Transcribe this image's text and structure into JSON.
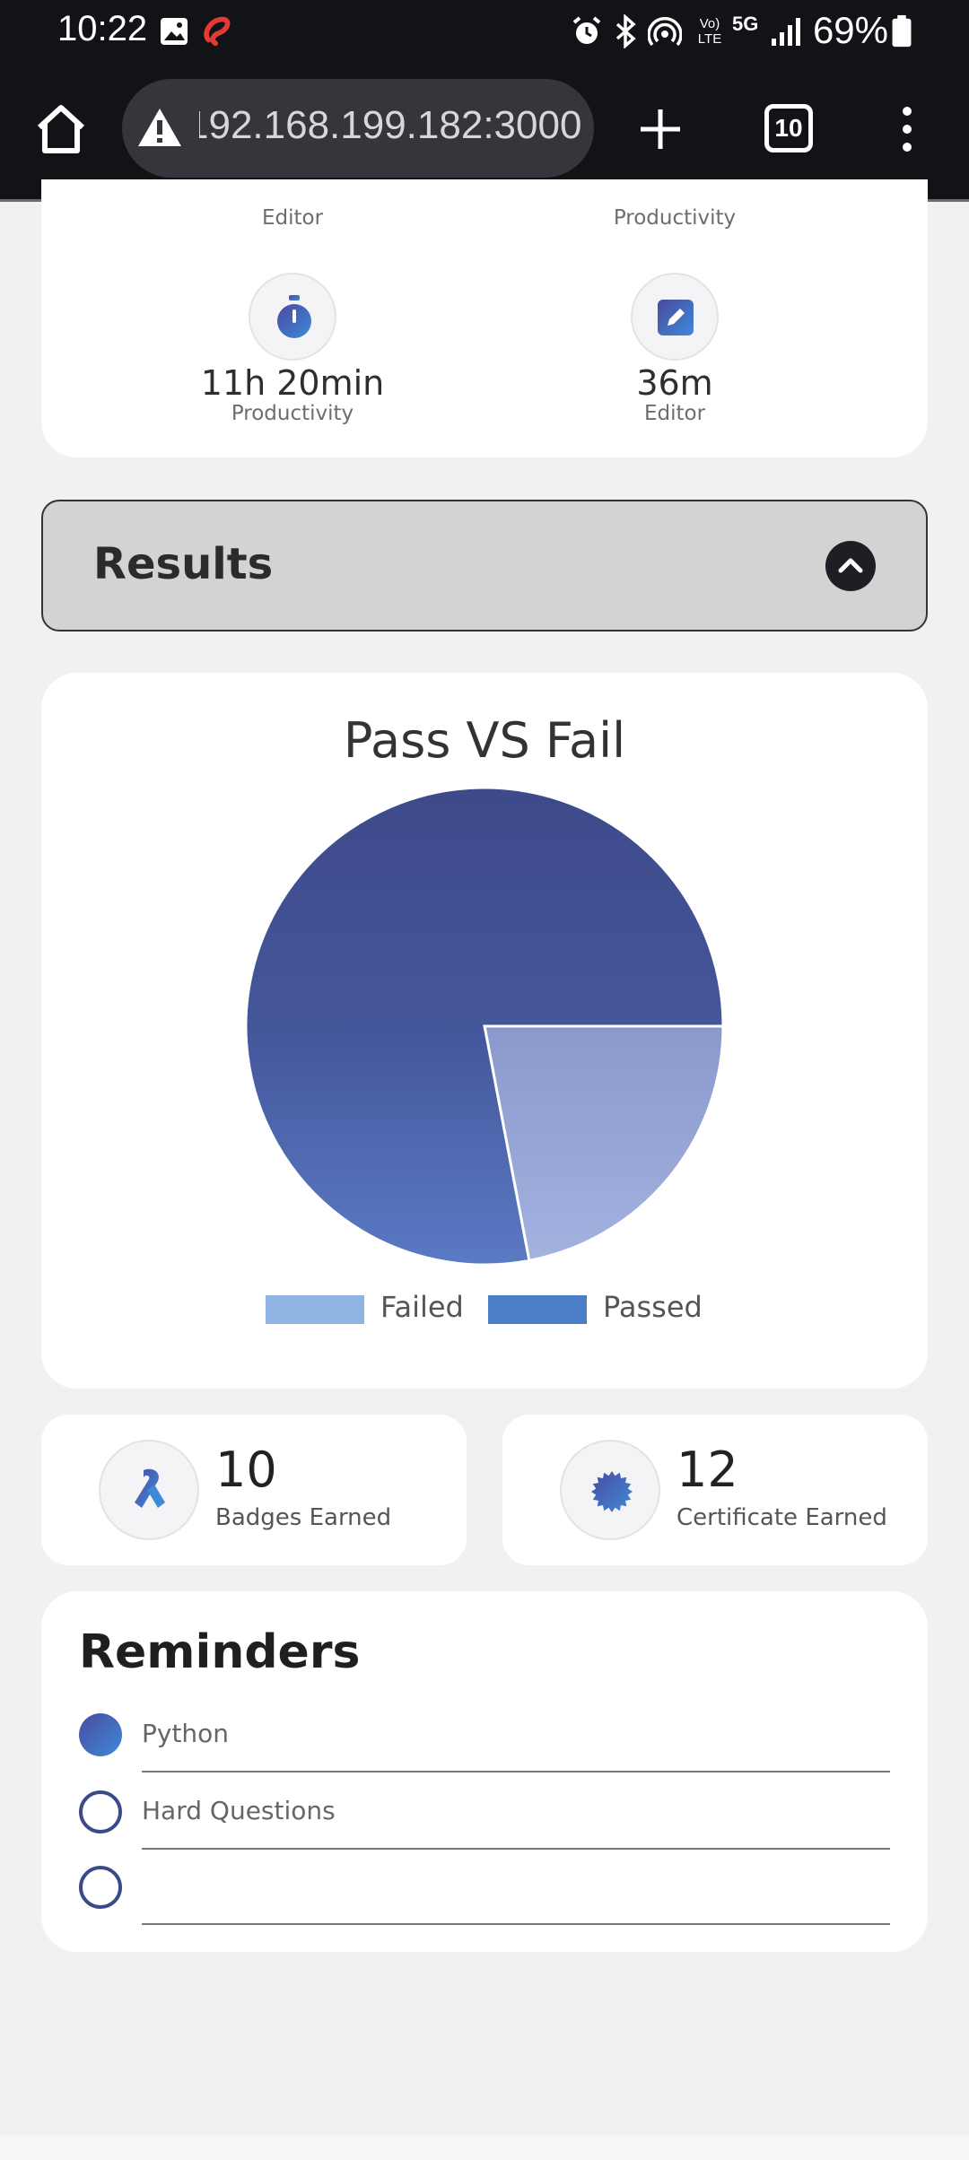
{
  "status_bar": {
    "time": "10:22",
    "battery": "69%",
    "network": "5G",
    "volte": "Vo) LTE"
  },
  "browser": {
    "url": "192.168.199.182:3000",
    "tab_count": "10"
  },
  "stats": {
    "top_labels": [
      "Editor",
      "Productivity"
    ],
    "items": [
      {
        "value": "11h 20min",
        "label": "Productivity",
        "icon": "stopwatch-icon"
      },
      {
        "value": "36m",
        "label": "Editor",
        "icon": "pencil-icon"
      }
    ]
  },
  "results": {
    "title": "Results"
  },
  "chart_data": {
    "type": "pie",
    "title": "Pass VS Fail",
    "slices": [
      {
        "label": "Passed",
        "value": 78
      },
      {
        "label": "Failed",
        "value": 22
      }
    ],
    "legend": [
      "Failed",
      "Passed"
    ],
    "legend_position": "bottom",
    "colors": {
      "Failed": "#8fb3e3",
      "Passed": "#4a7ec8",
      "Passed_slice": "#43508e",
      "Failed_slice": "#9aa8d8"
    }
  },
  "achievements": [
    {
      "count": "10",
      "label": "Badges Earned",
      "icon": "ribbon-icon"
    },
    {
      "count": "12",
      "label": "Certificate Earned",
      "icon": "certificate-icon"
    }
  ],
  "reminders": {
    "title": "Reminders",
    "items": [
      {
        "text": "Python",
        "checked": true
      },
      {
        "text": "Hard Questions",
        "checked": false
      },
      {
        "text": "",
        "checked": false
      }
    ]
  }
}
